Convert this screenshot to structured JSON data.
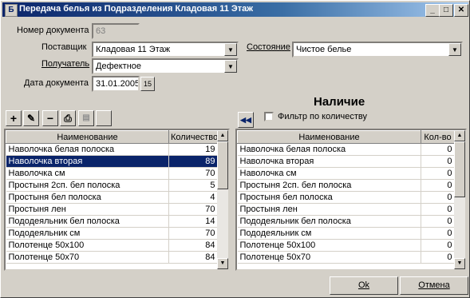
{
  "window": {
    "title": "Передача белья из Подразделения Кладовая 11 Этаж",
    "app_icon": "table-icon"
  },
  "form": {
    "doc_number_label": "Номер документа",
    "doc_number_value": "63",
    "supplier_label": "Поставщик",
    "supplier_value": "Кладовая 11 Этаж",
    "receiver_label": "Получатель",
    "receiver_value": "Дефектное",
    "date_label": "Дата документа",
    "date_value": "31.01.2005",
    "state_label": "Состояние",
    "state_value": "Чистое белье",
    "calendar_icon": "15"
  },
  "toolbar": {
    "add": "+",
    "edit": "✎",
    "remove": "−",
    "print": "⎙"
  },
  "availability": {
    "title": "Наличие",
    "filter_label": "Фильтр по количеству",
    "filter_checked": false
  },
  "left_grid": {
    "headers": [
      "Наименование",
      "Количество"
    ],
    "rows": [
      {
        "name": "Наволочка белая полоска",
        "qty": "19"
      },
      {
        "name": "Наволочка вторая",
        "qty": "89"
      },
      {
        "name": "Наволочка см",
        "qty": "70"
      },
      {
        "name": "Простыня 2сп. бел полоска",
        "qty": "5"
      },
      {
        "name": "Простыня бел полоска",
        "qty": "4"
      },
      {
        "name": "Простыня лен",
        "qty": "70"
      },
      {
        "name": "Пододеяльник бел полоска",
        "qty": "14"
      },
      {
        "name": "Пододеяльник см",
        "qty": "70"
      },
      {
        "name": "Полотенце 50х100",
        "qty": "84"
      },
      {
        "name": "Полотенце 50х70",
        "qty": "84"
      }
    ],
    "selected_index": 1
  },
  "right_grid": {
    "headers": [
      "Наименование",
      "Кол-во"
    ],
    "rows": [
      {
        "name": "Наволочка белая полоска",
        "qty": "0"
      },
      {
        "name": "Наволочка вторая",
        "qty": "0"
      },
      {
        "name": "Наволочка см",
        "qty": "0"
      },
      {
        "name": "Простыня 2сп. бел полоска",
        "qty": "0"
      },
      {
        "name": "Простыня бел полоска",
        "qty": "0"
      },
      {
        "name": "Простыня лен",
        "qty": "0"
      },
      {
        "name": "Пододеяльник бел полоска",
        "qty": "0"
      },
      {
        "name": "Пододеяльник см",
        "qty": "0"
      },
      {
        "name": "Полотенце 50х100",
        "qty": "0"
      },
      {
        "name": "Полотенце 50х70",
        "qty": "0"
      }
    ]
  },
  "buttons": {
    "ok": "Ok",
    "cancel": "Отмена"
  },
  "colors": {
    "title_bar": "#0a246a",
    "selection": "#0a246a",
    "face": "#d4d0c8"
  }
}
